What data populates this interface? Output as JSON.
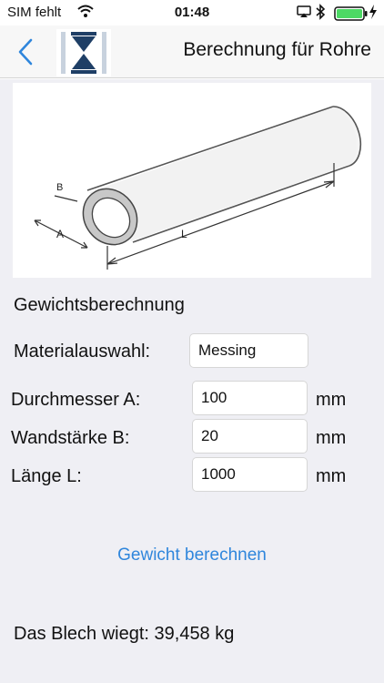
{
  "status_bar": {
    "carrier": "SIM fehlt",
    "time": "01:48",
    "icons": [
      "wifi-icon",
      "airplay-icon",
      "bluetooth-icon",
      "battery-icon",
      "charging-icon"
    ]
  },
  "nav": {
    "title": "Berechnung für Rohre",
    "back_icon": "chevron-left-icon",
    "logo_icon": "app-logo-icon"
  },
  "diagram": {
    "label_a": "A",
    "label_b": "B",
    "label_l": "L"
  },
  "form": {
    "section_title": "Gewichtsberechnung",
    "material_label": "Materialauswahl:",
    "material_value": "Messing",
    "diameter_label": "Durchmesser A:",
    "diameter_value": "100",
    "diameter_unit": "mm",
    "wall_label": "Wandstärke B:",
    "wall_value": "20",
    "wall_unit": "mm",
    "length_label": "Länge L:",
    "length_value": "1000",
    "length_unit": "mm"
  },
  "actions": {
    "calculate_label": "Gewicht berechnen"
  },
  "result": {
    "text": "Das Blech wiegt: 39,458 kg"
  },
  "colors": {
    "accent": "#2f86dc",
    "logo_dark": "#1f3f66"
  }
}
